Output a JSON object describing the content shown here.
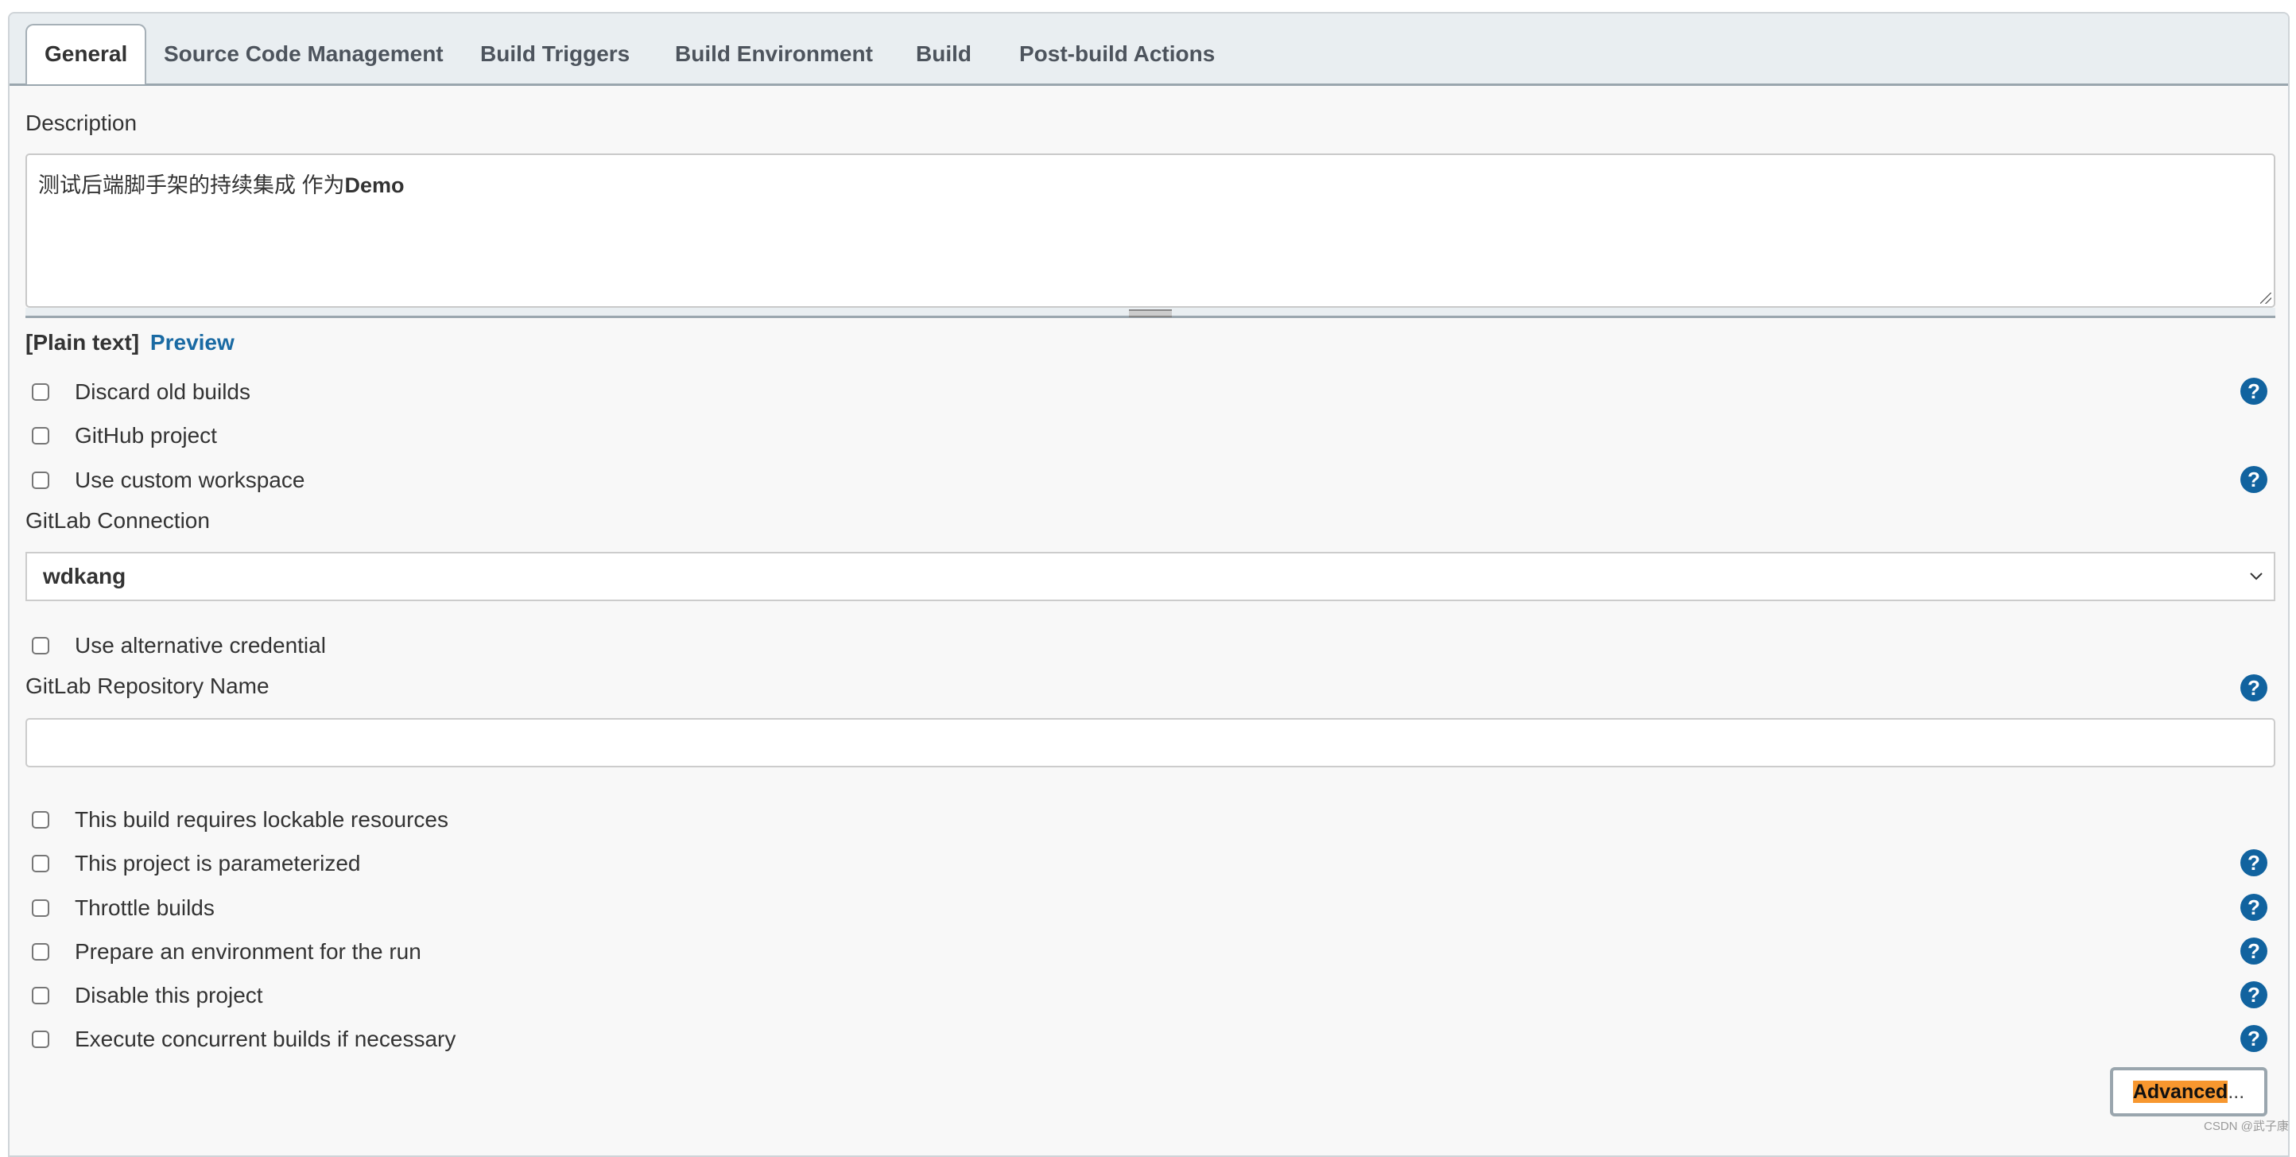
{
  "tabs": [
    {
      "label": "General",
      "active": true
    },
    {
      "label": "Source Code Management",
      "active": false
    },
    {
      "label": "Build Triggers",
      "active": false
    },
    {
      "label": "Build Environment",
      "active": false
    },
    {
      "label": "Build",
      "active": false
    },
    {
      "label": "Post-build Actions",
      "active": false
    }
  ],
  "description": {
    "label": "Description",
    "value_text": "测试后端脚手架的持续集成 作为",
    "value_bold": "Demo",
    "markup_plain": "[Plain text]",
    "markup_preview": "Preview"
  },
  "options_top": [
    {
      "label": "Discard old builds",
      "checked": false,
      "help": true
    },
    {
      "label": "GitHub project",
      "checked": false,
      "help": false
    },
    {
      "label": "Use custom workspace",
      "checked": false,
      "help": true
    }
  ],
  "gitlab_connection": {
    "label": "GitLab Connection",
    "selected": "wdkang",
    "icon": "chevron-down-icon"
  },
  "alt_credential": {
    "label": "Use alternative credential",
    "checked": false
  },
  "gitlab_repo": {
    "label": "GitLab Repository Name",
    "value": "",
    "help": true
  },
  "options_bottom": [
    {
      "label": "This build requires lockable resources",
      "checked": false,
      "help": false
    },
    {
      "label": "This project is parameterized",
      "checked": false,
      "help": true
    },
    {
      "label": "Throttle builds",
      "checked": false,
      "help": true
    },
    {
      "label": "Prepare an environment for the run",
      "checked": false,
      "help": true
    },
    {
      "label": "Disable this project",
      "checked": false,
      "help": true
    },
    {
      "label": "Execute concurrent builds if necessary",
      "checked": false,
      "help": true
    }
  ],
  "help_icon": {
    "glyph": "?",
    "color": "#11639f"
  },
  "advanced_button": {
    "highlight": "Advanced",
    "suffix": "...",
    "highlight_color": "#f7972f"
  },
  "watermark": "CSDN @武子康"
}
